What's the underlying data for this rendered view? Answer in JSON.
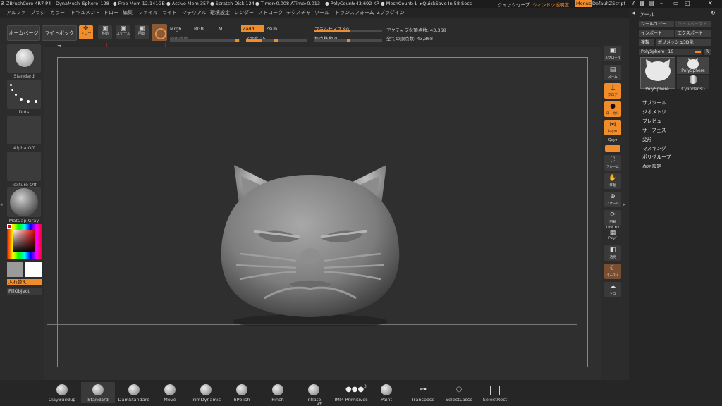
{
  "titlebar": {
    "app": "ZBrushCore 4R7 P4",
    "file": "DynaMesh_Sphere_128",
    "free_mem": "● Free Mem 12.141GB",
    "active_mem": "● Active Mem 357",
    "scratch": "● Scratch Disk 124",
    "timer": "● Timer▸0.008 ATime▸0.013",
    "polycount": "● PolyCount▸43.692 KP",
    "meshcount": "● MeshCount▸1",
    "quicksave": "▸QuickSave In 58 Secs",
    "quicksave_btn": "クイックセーブ",
    "transparency": "ウィンドウ透明度",
    "menus": "Menus",
    "script": "DefaultZScript"
  },
  "menubar": [
    "アルファ",
    "ブラシ",
    "カラー",
    "ドキュメント",
    "ドロー",
    "編集",
    "ファイル",
    "ライト",
    "マテリアル",
    "環境設定",
    "レンダー",
    "ストローク",
    "テクスチャ",
    "ツール",
    "トランスフォーム",
    "Zプラグイン"
  ],
  "toolbar": {
    "home": "ホームページ",
    "lightbox": "ライトボックス",
    "draw": "ドロー",
    "move": "移動",
    "scale": "スケール",
    "rotate": "回転",
    "mrgb": "Mrgb",
    "rgb": "RGB",
    "m": "M",
    "zadd": "Zadd",
    "zsub": "Zsub",
    "rgb_intensity": "Rgb強度",
    "z_intensity": "Z強度 25",
    "brush_size": "ブラシサイズ 80",
    "focal_shift": "焦点移動 0",
    "active_points": "アクティブな頂点数: 43,368",
    "total_points": "全ての頂点数: 43,368",
    "z_intensity_value": 25,
    "brush_size_value": 80,
    "focal_shift_value": 0
  },
  "leftshelf": {
    "brush": "Standard",
    "stroke": "Dots",
    "alpha": "Alpha Off",
    "texture": "Texture Off",
    "material": "MatCap Gray",
    "swap": "入れ替え",
    "fill": "FillObject"
  },
  "rightshelf": [
    "スクロール",
    "ズーム",
    "フロア",
    "ローカル",
    "Lsym",
    "Qxyz",
    "フレーム",
    "移動",
    "スケール",
    "回転",
    "Line Fill",
    "PolyF",
    "透明",
    "ゴースト",
    "ソロ"
  ],
  "rpanel": {
    "title": "ツール",
    "copy": "ツールコピー",
    "paste": "ツールペースト",
    "import": "インポート",
    "export": "エクスポート",
    "clone": "複製",
    "make3d": "ポリメッシュ3D化",
    "polysphere_label": "PolySphere",
    "polysphere_value": "16",
    "r": "R",
    "tool1": "PolySphere",
    "tool2": "PolySphere",
    "tool3": "Cylinder3D",
    "items": [
      "サブツール",
      "ジオメトリ",
      "プレビュー",
      "サーフェス",
      "変形",
      "マスキング",
      "ポリグループ",
      "表示設定"
    ]
  },
  "bottom": [
    "ClayBuildup",
    "Standard",
    "DamStandard",
    "Move",
    "TrimDynamic",
    "hPolish",
    "Pinch",
    "Inflate",
    "IMM Primitives",
    "Paint",
    "Transpose",
    "SelectLasso",
    "SelectRect"
  ],
  "bottom_imm_count": "3"
}
